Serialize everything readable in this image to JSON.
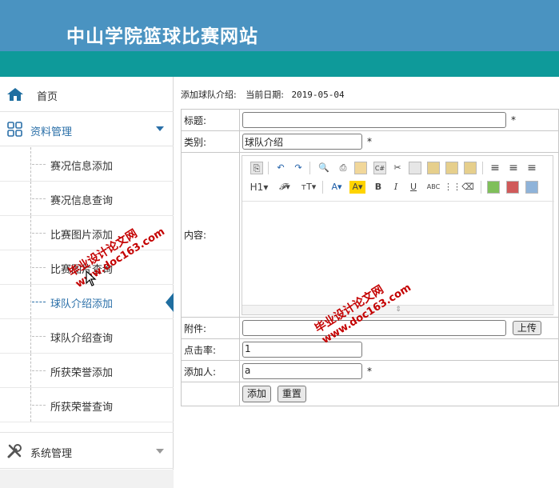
{
  "header": {
    "title": "中山学院篮球比赛网站"
  },
  "sidebar": {
    "home": "首页",
    "group": "资料管理",
    "items": [
      {
        "label": "赛况信息添加"
      },
      {
        "label": "赛况信息查询"
      },
      {
        "label": "比赛图片添加"
      },
      {
        "label": "比赛图片查询"
      },
      {
        "label": "球队介绍添加"
      },
      {
        "label": "球队介绍查询"
      },
      {
        "label": "所获荣誉添加"
      },
      {
        "label": "所获荣誉查询"
      }
    ],
    "active_index": 4,
    "system": "系统管理"
  },
  "main": {
    "page_label": "添加球队介绍:",
    "date_label": "当前日期:",
    "date_value": "2019-05-04",
    "fields": {
      "title_label": "标题:",
      "title_value": "",
      "category_label": "类别:",
      "category_value": "球队介绍",
      "content_label": "内容:",
      "attachment_label": "附件:",
      "upload_button": "上传",
      "clicks_label": "点击率:",
      "clicks_value": "1",
      "adder_label": "添加人:",
      "adder_value": "a",
      "required_mark": "*"
    },
    "buttons": {
      "add": "添加",
      "reset": "重置"
    }
  },
  "editor": {
    "toolbar_row1": [
      "source-icon",
      "undo-icon",
      "redo-icon",
      "preview-icon",
      "print-icon",
      "template-icon",
      "code-icon",
      "cut-icon",
      "copy-icon",
      "paste-icon",
      "paste-text-icon",
      "paste-word-icon",
      "align-left-icon",
      "align-center-icon",
      "align-right-icon"
    ],
    "toolbar_row2": [
      "H1",
      "F",
      "T",
      "A",
      "A",
      "B",
      "I",
      "U",
      "ABC",
      "select-all-icon",
      "eraser-icon",
      "image-icon",
      "flash-icon",
      "link-icon"
    ]
  },
  "watermark": {
    "line1": "毕业设计论文网",
    "line2": "www.doc163.com"
  },
  "colors": {
    "header": "#4a93c1",
    "teal": "#0e9a9a",
    "accent": "#2a6fa8",
    "watermark": "#c40000"
  }
}
